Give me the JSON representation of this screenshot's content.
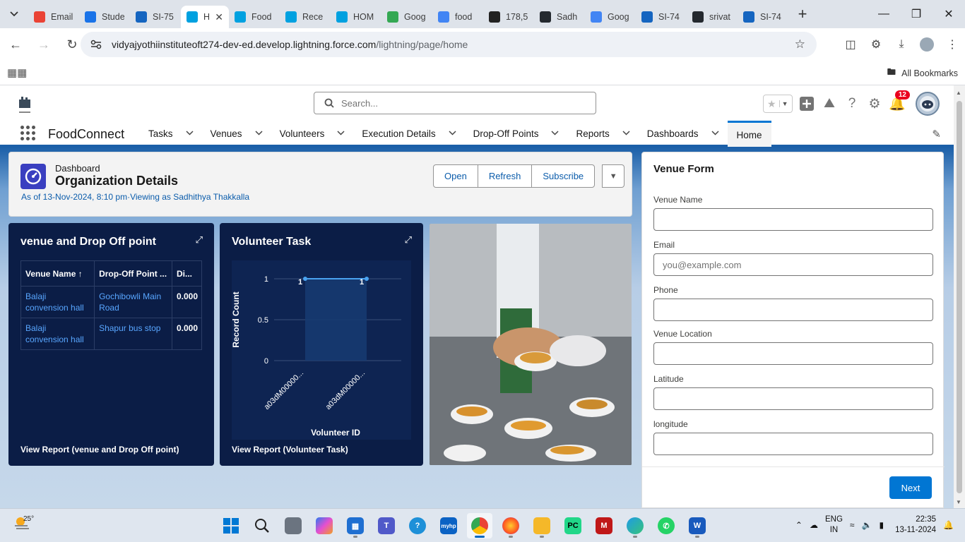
{
  "browser": {
    "tabs": [
      {
        "title": "Email",
        "icon": "gmail-icon",
        "color": "#ea4335"
      },
      {
        "title": "Stude",
        "icon": "monitor-icon",
        "color": "#1a73e8"
      },
      {
        "title": "SI-75",
        "icon": "board-icon",
        "color": "#1565c0"
      },
      {
        "title": "H",
        "icon": "salesforce-icon",
        "color": "#00a1e0",
        "active": true
      },
      {
        "title": "Food",
        "icon": "salesforce-icon",
        "color": "#00a1e0"
      },
      {
        "title": "Rece",
        "icon": "salesforce-icon",
        "color": "#00a1e0"
      },
      {
        "title": "HOM",
        "icon": "salesforce-icon",
        "color": "#00a1e0"
      },
      {
        "title": "Goog",
        "icon": "gallery-icon",
        "color": "#34a853"
      },
      {
        "title": "food",
        "icon": "google-icon",
        "color": "#4285f4"
      },
      {
        "title": "178,5",
        "icon": "is-icon",
        "color": "#222222"
      },
      {
        "title": "Sadh",
        "icon": "github-icon",
        "color": "#24292f"
      },
      {
        "title": "Goog",
        "icon": "google-icon",
        "color": "#4285f4"
      },
      {
        "title": "SI-74",
        "icon": "board-icon",
        "color": "#1565c0"
      },
      {
        "title": "srivat",
        "icon": "github-icon",
        "color": "#24292f"
      },
      {
        "title": "SI-74",
        "icon": "board-icon",
        "color": "#1565c0"
      }
    ],
    "url_host": "vidyajyothiinstituteoft274-dev-ed.develop.lightning.force.com",
    "url_path": "/lightning/page/home",
    "all_bookmarks": "All Bookmarks"
  },
  "sf": {
    "search_placeholder": "Search...",
    "notifications_count": "12",
    "app_name": "FoodConnect",
    "nav": [
      {
        "label": "Tasks",
        "menu": true
      },
      {
        "label": "Venues",
        "menu": true
      },
      {
        "label": "Volunteers",
        "menu": true
      },
      {
        "label": "Execution Details",
        "menu": true
      },
      {
        "label": "Drop-Off Points",
        "menu": true
      },
      {
        "label": "Reports",
        "menu": true
      },
      {
        "label": "Dashboards",
        "menu": true
      },
      {
        "label": "Home",
        "menu": false,
        "active": true
      }
    ]
  },
  "dashboard": {
    "type_label": "Dashboard",
    "title": "Organization Details",
    "meta": "As of 13-Nov-2024, 8:10 pm·Viewing as Sadhithya Thakkalla",
    "buttons": {
      "open": "Open",
      "refresh": "Refresh",
      "subscribe": "Subscribe"
    }
  },
  "widget_table": {
    "title": "venue and Drop Off point",
    "columns": [
      "Venue Name ↑",
      "Drop-Off Point ...",
      "Di..."
    ],
    "rows": [
      [
        "Balaji convension hall",
        "Gochibowli Main Road",
        "0.000"
      ],
      [
        "Balaji convension hall",
        "Shapur bus stop",
        "0.000"
      ]
    ],
    "link": "View Report (venue and Drop Off point)"
  },
  "widget_chart": {
    "title": "Volunteer Task",
    "link": "View Report (Volunteer Task)"
  },
  "chart_data": {
    "type": "line",
    "title": "Volunteer Task",
    "xlabel": "Volunteer ID",
    "ylabel": "Record Count",
    "categories": [
      "a03dM00000...",
      "a03dM00000..."
    ],
    "values": [
      1,
      1
    ],
    "data_labels": [
      "1",
      "1"
    ],
    "ylim": [
      0,
      1
    ],
    "yticks": [
      "0",
      "0.5",
      "1"
    ],
    "grid": true,
    "line_color": "#4aa3f0"
  },
  "venue_form": {
    "title": "Venue Form",
    "fields": [
      {
        "label": "Venue Name",
        "value": "",
        "placeholder": ""
      },
      {
        "label": "Email",
        "value": "",
        "placeholder": "you@example.com"
      },
      {
        "label": "Phone",
        "value": "",
        "placeholder": ""
      },
      {
        "label": "Venue Location",
        "value": "",
        "placeholder": ""
      },
      {
        "label": "Latitude",
        "value": "",
        "placeholder": ""
      },
      {
        "label": "longitude",
        "value": "",
        "placeholder": ""
      }
    ],
    "next_label": "Next"
  },
  "taskbar": {
    "temperature": "25°",
    "lang_top": "ENG",
    "lang_bottom": "IN",
    "time": "22:35",
    "date": "13-11-2024"
  }
}
